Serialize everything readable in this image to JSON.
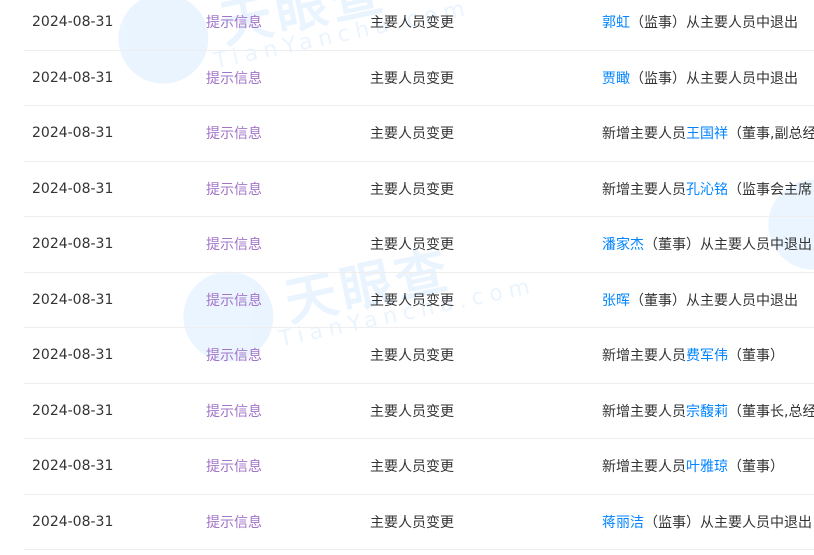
{
  "watermark": {
    "brand": "天眼查",
    "domain": "TianYancha.com"
  },
  "rows": [
    {
      "date": "2024-08-31",
      "level": "提示信息",
      "type": "主要人员变更",
      "prefix": "",
      "name": "郭虹",
      "suffix": "（监事）从主要人员中退出"
    },
    {
      "date": "2024-08-31",
      "level": "提示信息",
      "type": "主要人员变更",
      "prefix": "",
      "name": "贾瞰",
      "suffix": "（监事）从主要人员中退出"
    },
    {
      "date": "2024-08-31",
      "level": "提示信息",
      "type": "主要人员变更",
      "prefix": "新增主要人员",
      "name": "王国祥",
      "suffix": "（董事,副总经"
    },
    {
      "date": "2024-08-31",
      "level": "提示信息",
      "type": "主要人员变更",
      "prefix": "新增主要人员",
      "name": "孔沁铭",
      "suffix": "（监事会主席"
    },
    {
      "date": "2024-08-31",
      "level": "提示信息",
      "type": "主要人员变更",
      "prefix": "",
      "name": "潘家杰",
      "suffix": "（董事）从主要人员中退出"
    },
    {
      "date": "2024-08-31",
      "level": "提示信息",
      "type": "主要人员变更",
      "prefix": "",
      "name": "张晖",
      "suffix": "（董事）从主要人员中退出"
    },
    {
      "date": "2024-08-31",
      "level": "提示信息",
      "type": "主要人员变更",
      "prefix": "新增主要人员",
      "name": "费军伟",
      "suffix": "（董事）"
    },
    {
      "date": "2024-08-31",
      "level": "提示信息",
      "type": "主要人员变更",
      "prefix": "新增主要人员",
      "name": "宗馥莉",
      "suffix": "（董事长,总经"
    },
    {
      "date": "2024-08-31",
      "level": "提示信息",
      "type": "主要人员变更",
      "prefix": "新增主要人员",
      "name": "叶雅琼",
      "suffix": "（董事）"
    },
    {
      "date": "2024-08-31",
      "level": "提示信息",
      "type": "主要人员变更",
      "prefix": "",
      "name": "蒋丽洁",
      "suffix": "（监事）从主要人员中退出"
    }
  ]
}
